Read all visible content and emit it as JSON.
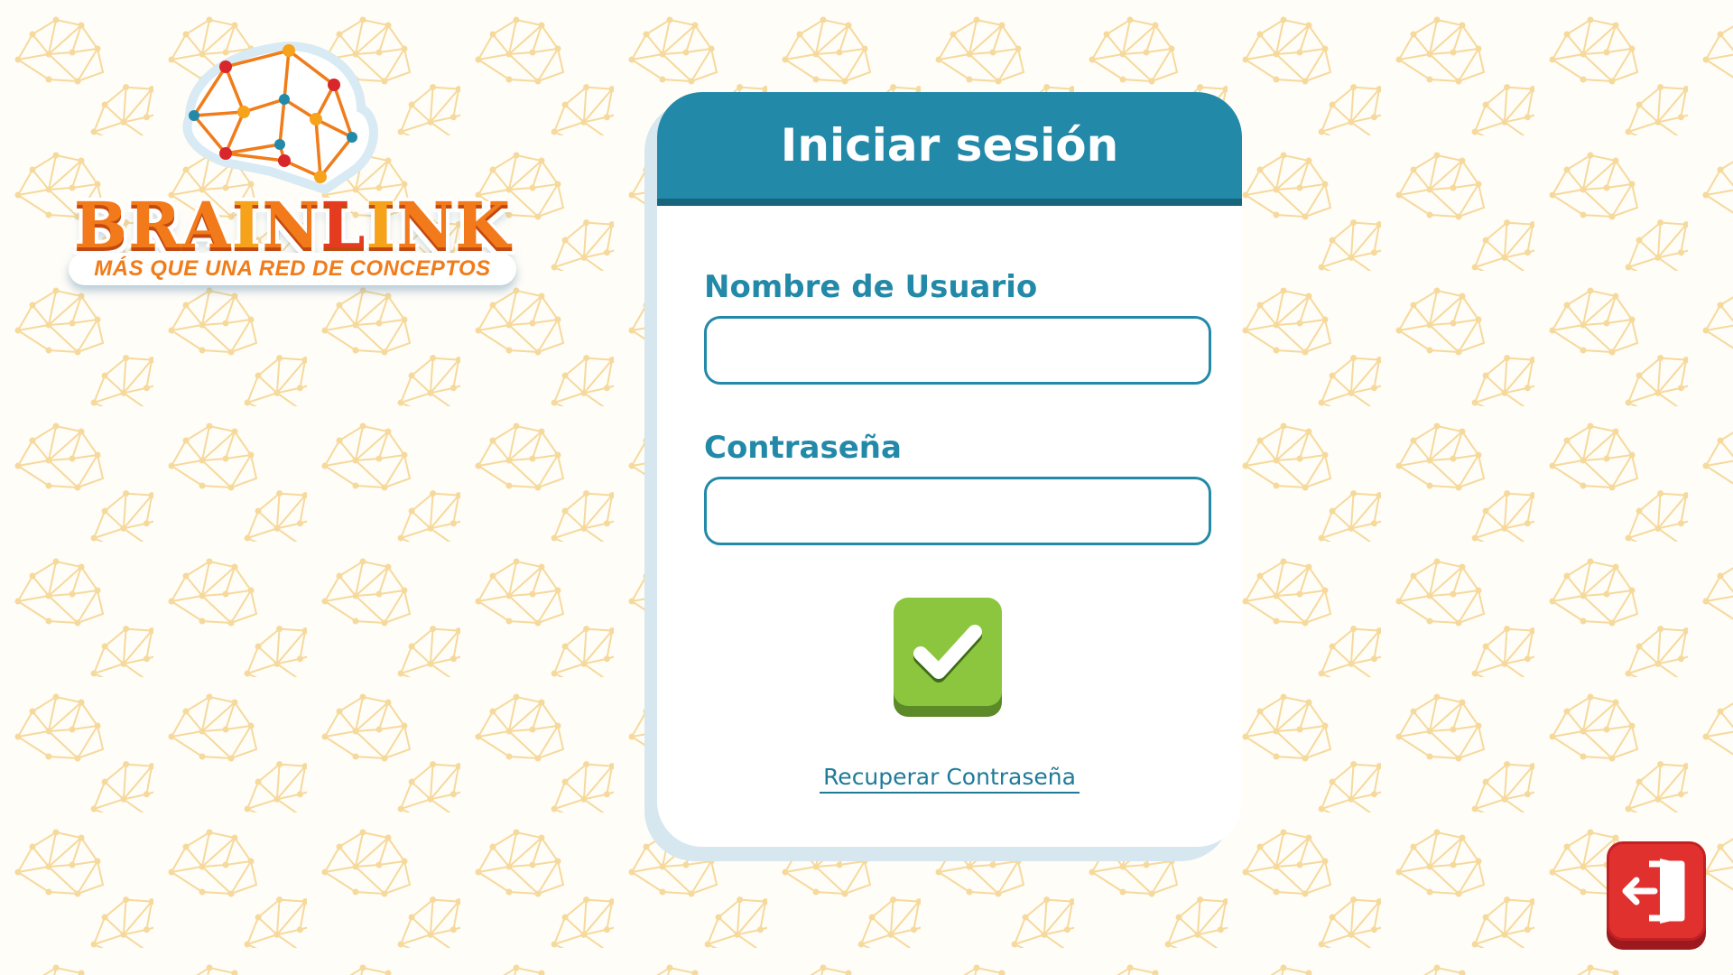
{
  "logo": {
    "brand_parts": [
      "BRA",
      "I",
      "N",
      "L",
      "I",
      "N",
      "K"
    ],
    "tagline": "MÁS QUE UNA RED DE CONCEPTOS"
  },
  "login": {
    "title": "Iniciar sesión",
    "username_label": "Nombre de Usuario",
    "username_value": "",
    "password_label": "Contraseña",
    "password_value": "",
    "submit_icon": "checkmark-icon",
    "recover_link": "Recuperar Contraseña"
  },
  "exit": {
    "icon": "logout-door-icon"
  },
  "colors": {
    "primary": "#2389a8",
    "primary_dark": "#17647d",
    "accent_green": "#8cc63f",
    "exit_red": "#e0312f",
    "pattern": "#f6d99c",
    "logo_orange": "#f27a1b"
  }
}
